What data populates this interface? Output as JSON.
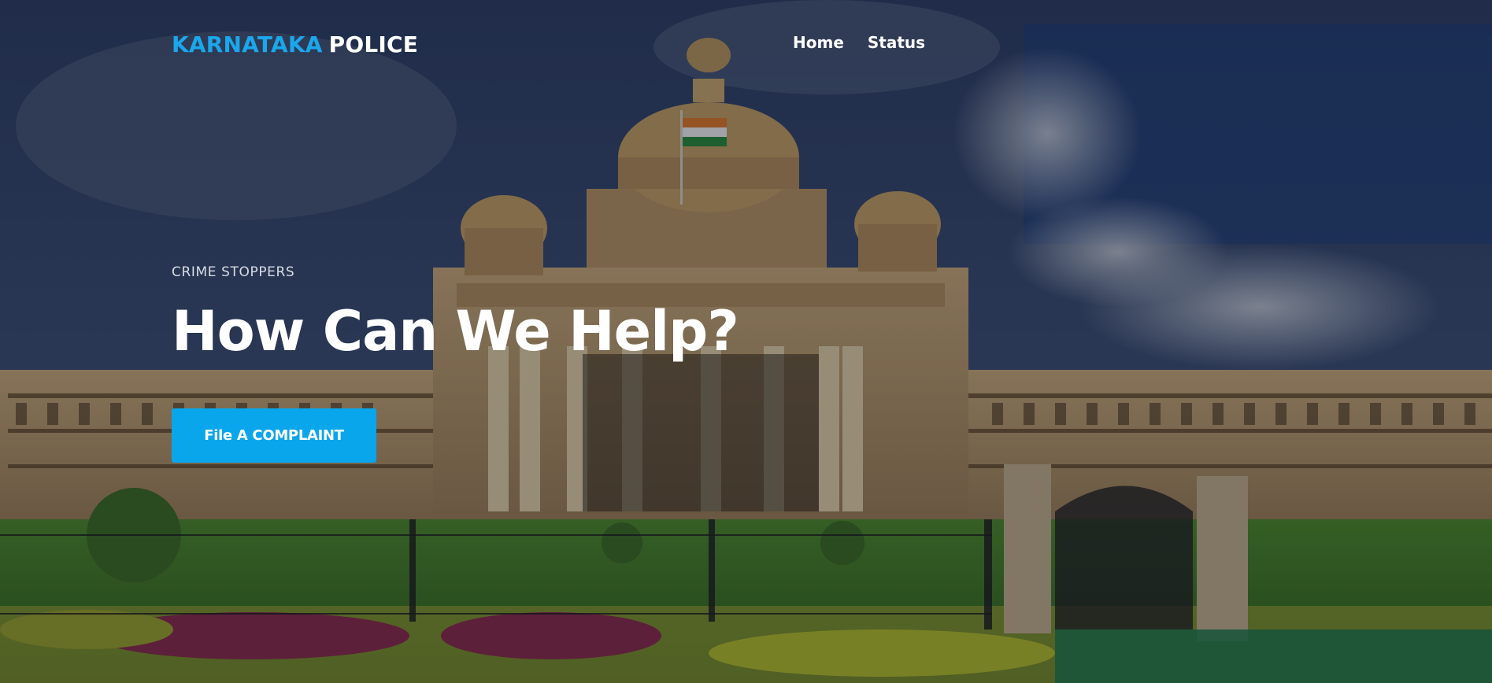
{
  "brand": {
    "part1": "KARNATAKA",
    "part2": "POLICE",
    "accent_color": "#1aa7ec"
  },
  "nav": {
    "items": [
      {
        "label": "Home"
      },
      {
        "label": "Status"
      }
    ]
  },
  "hero": {
    "eyebrow": "CRIME STOPPERS",
    "title": "How Can We Help?",
    "cta_label": "File A COMPLAINT",
    "cta_color": "#0aa6ec",
    "background": "vidhana-soudha-photo"
  }
}
